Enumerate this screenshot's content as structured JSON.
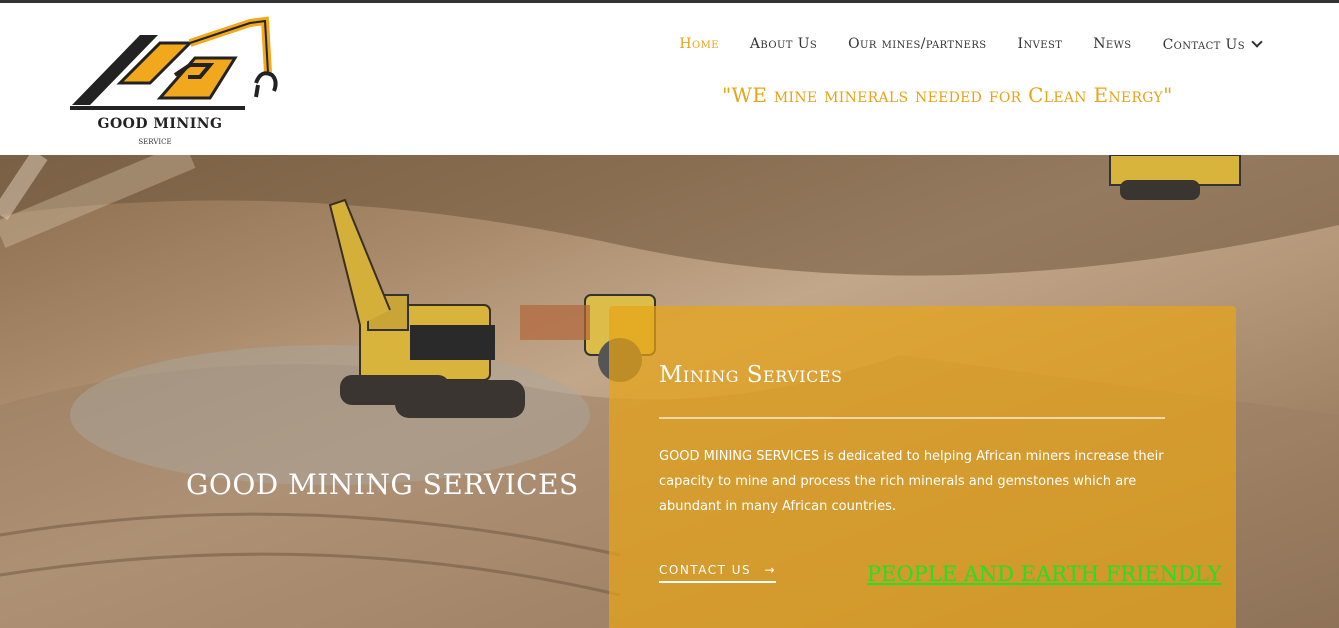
{
  "brand": {
    "name": "GOOD MINING",
    "sub": "SERVICE"
  },
  "nav": [
    {
      "label": "Home",
      "active": true
    },
    {
      "label": "About Us"
    },
    {
      "label": "Our mines/partners"
    },
    {
      "label": "Invest"
    },
    {
      "label": "News"
    },
    {
      "label": "Contact Us",
      "dropdown": true
    }
  ],
  "tagline": "\"WE mine minerals needed for Clean Energy\"",
  "hero": {
    "title": "GOOD MINING SERVICES",
    "card": {
      "heading": "Mining Services",
      "body": "GOOD MINING SERVICES is dedicated to helping African miners increase their capacity to mine and process the rich minerals and gemstones which are abundant in many African countries.",
      "cta": "CONTACT US",
      "cta_arrow": "→",
      "friendly": "PEOPLE AND EARTH FRIENDLY"
    }
  },
  "colors": {
    "accent": "#e8a317",
    "green": "#22e022"
  }
}
